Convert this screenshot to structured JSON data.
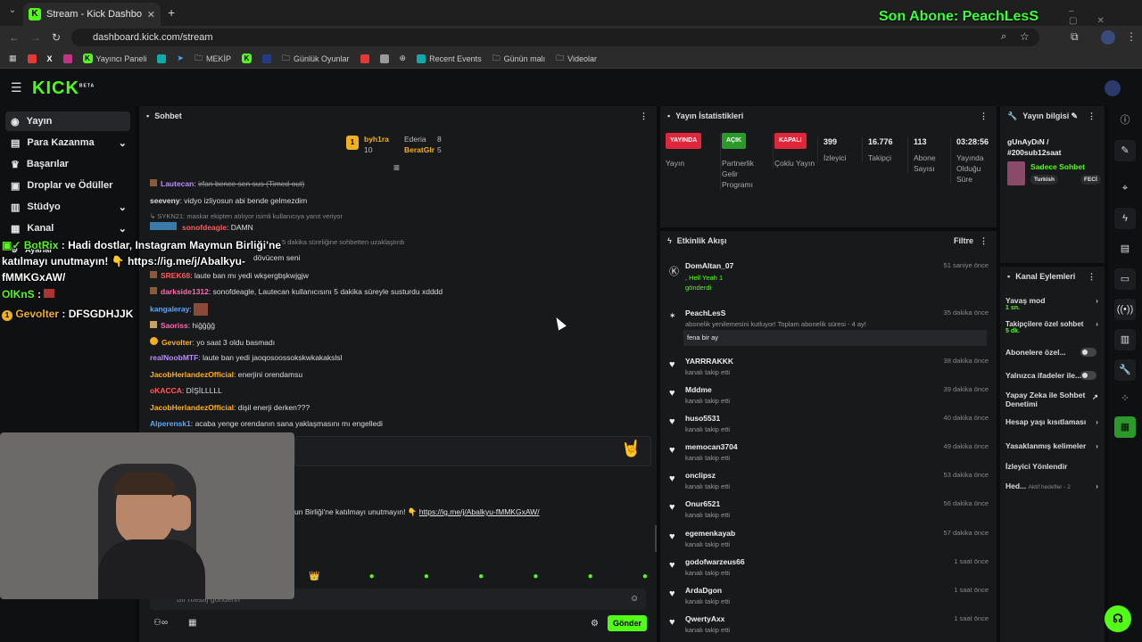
{
  "browser": {
    "tab_title": "Stream - Kick Dashboard",
    "url": "dashboard.kick.com/stream",
    "bookmarks": [
      "Yayıncı Paneli",
      "MEKİP",
      "Günlük Oyunlar",
      "Recent Events",
      "Günün malı",
      "Videolar"
    ]
  },
  "overlay": {
    "last_sub": "Son Abone: PeachLesS",
    "chat_overlay": [
      {
        "user": "BotRix",
        "text": ": Hadi dostlar, Instagram Maymun Birliği'ne katılmayı unutmayın! 👇 https://ig.me/j/Abalkyu-fMMKGxAW/"
      },
      {
        "user": "OlKnS",
        "text": ":"
      },
      {
        "user": "Gevolter",
        "text": ": DFSGDHJJK"
      }
    ]
  },
  "app": {
    "logo": "KICK",
    "beta": "BETA"
  },
  "sidebar": {
    "items": [
      {
        "label": "Yayın"
      },
      {
        "label": "Para Kazanma"
      },
      {
        "label": "Başarılar"
      },
      {
        "label": "Droplar ve Ödüller"
      },
      {
        "label": "Stüdyo"
      },
      {
        "label": "Kanal"
      },
      {
        "label": "Ayarlar"
      }
    ]
  },
  "chat": {
    "title": "Sohbet",
    "top_gifters": [
      {
        "name": "byh1ra",
        "count": "10"
      },
      {
        "name": "Ederia",
        "count": "8"
      },
      {
        "name": "BeratGlr",
        "count": "5"
      }
    ],
    "messages": [
      {
        "user": "Lautecan",
        "text": "irfan bence sen sus (Timed out)",
        "color": "#b98cff"
      },
      {
        "user": "seeveny",
        "text": "vidyo izliyosun abi bende gelmezdim",
        "color": "#eeeeee"
      },
      {
        "user": "SYKN21",
        "text": "maskar ekipten atılıyor isimli kullanıcıya yanıt veriyor",
        "color": "#888888"
      },
      {
        "user": "sonofdeagle",
        "text": "DAMN",
        "color": "#ff5a5a"
      },
      {
        "user": "",
        "text": "5 dakika süreliğine sohbetten uzaklaştırdı",
        "color": "#888888"
      },
      {
        "user": "",
        "text": "dövücem seni",
        "color": "#eeeeee"
      },
      {
        "user": "SREK68",
        "text": "laute ban mı yedi wkşergbşkwjgjw",
        "color": "#ff5a5a"
      },
      {
        "user": "darkside1312",
        "text": "sonofdeagle, Lautecan kullanıcısını 5 dakika süreyle susturdu xdddd",
        "color": "#ff6bb0"
      },
      {
        "user": "kangaleray",
        "text": "",
        "color": "#5aa8ff"
      },
      {
        "user": "Saoriss",
        "text": "hiğğğğ",
        "color": "#ff6bb0"
      },
      {
        "user": "Gevolter",
        "text": "yo saat 3 oldu basmadı",
        "color": "#ffb020"
      },
      {
        "user": "realNoobMTF",
        "text": "laute ban yedi jaoqosoossokskwkakakslsl",
        "color": "#b98cff"
      },
      {
        "user": "JacobHerlandezOfficial",
        "text": "enerjini orendamsu",
        "color": "#ffb020"
      },
      {
        "user": "oKACCA",
        "text": "DİŞİLLLLL",
        "color": "#ff5a5a"
      },
      {
        "user": "JacobHerlandezOfficial",
        "text": "dişil enerji derken???",
        "color": "#ffb020"
      },
      {
        "user": "Alperensk1",
        "text": "acaba yenge orendanın sana yaklaşmasını mı engelledi",
        "color": "#5aa8ff"
      }
    ],
    "pinned_text": "un Birliği'ne katılmayı unutmayın! 👇",
    "pinned_link": "https://ig.me/j/Abalkyu-fMMKGxAW/",
    "input_placeholder": "Bir mesaj gönderin",
    "send_label": "Gönder"
  },
  "stats": {
    "title": "Yayın İstatistikleri",
    "items": [
      {
        "pill": "YAYINDA",
        "label": "Yayın",
        "color": "#e0263b"
      },
      {
        "pill": "AÇIK",
        "label": "Partnerlik Gelir Programı",
        "color": "#2b9a2b"
      },
      {
        "pill": "KAPALI",
        "label": "Çoklu Yayın",
        "color": "#e0263b"
      },
      {
        "value": "399",
        "label": "İzleyici"
      },
      {
        "value": "16.776",
        "label": "Takipçi"
      },
      {
        "value": "113",
        "label": "Abone Sayısı"
      },
      {
        "value": "03:28:56",
        "label": "Yayında Olduğu Süre"
      }
    ]
  },
  "activity": {
    "title": "Etkinlik Akışı",
    "filter": "Filtre",
    "events": [
      {
        "user": "DomAltan_07",
        "sub": ", Hell Yeah  1 gönderdi",
        "time": "51 saniye önce"
      },
      {
        "user": "PeachLesS",
        "sub": "abonelik yenilemesini kutluyor! Toplam abonelik süresi - 4 ay!",
        "msg": "fena bir ay",
        "time": "35 dakika önce"
      },
      {
        "user": "YARRRAKKK",
        "sub": "kanalı takip etti",
        "time": "38 dakika önce"
      },
      {
        "user": "Mddme",
        "sub": "kanalı takip etti",
        "time": "39 dakika önce"
      },
      {
        "user": "huso5531",
        "sub": "kanalı takip etti",
        "time": "40 dakika önce"
      },
      {
        "user": "memocan3704",
        "sub": "kanalı takip etti",
        "time": "49 dakika önce"
      },
      {
        "user": "onclipsz",
        "sub": "kanalı takip etti",
        "time": "53 dakika önce"
      },
      {
        "user": "Onur6521",
        "sub": "kanalı takip etti",
        "time": "56 dakika önce"
      },
      {
        "user": "egemenkayab",
        "sub": "kanalı takip etti",
        "time": "57 dakika önce"
      },
      {
        "user": "godofwarzeus66",
        "sub": "kanalı takip etti",
        "time": "1 saat önce"
      },
      {
        "user": "ArdaDgon",
        "sub": "kanalı takip etti",
        "time": "1 saat önce"
      },
      {
        "user": "QwertyAxx",
        "sub": "kanalı takip etti",
        "time": "1 saat önce"
      }
    ]
  },
  "info": {
    "title": "Yayın bilgisi",
    "stream_title": "gUnAyDıN / #200sub12saat",
    "mode": "Sadece Sohbet",
    "tags": [
      "Turkish",
      "FECİ"
    ]
  },
  "actions": {
    "title": "Kanal Eylemleri",
    "items": [
      {
        "label": "Yavaş mod",
        "sub": "1 sn."
      },
      {
        "label": "Takipçilere özel sohbet",
        "sub": "5 dk."
      },
      {
        "label": "Abonelere özel..."
      },
      {
        "label": "Yalnızca ifadeler ile..."
      },
      {
        "label": "Yapay Zeka ile Sohbet Denetimi"
      },
      {
        "label": "Hesap yaşı kısıtlaması"
      },
      {
        "label": "Yasaklanmış kelimeler"
      },
      {
        "label": "İzleyici Yönlendir"
      },
      {
        "label": "Hed...",
        "sub": "Aktif hedefler - 2"
      }
    ]
  }
}
